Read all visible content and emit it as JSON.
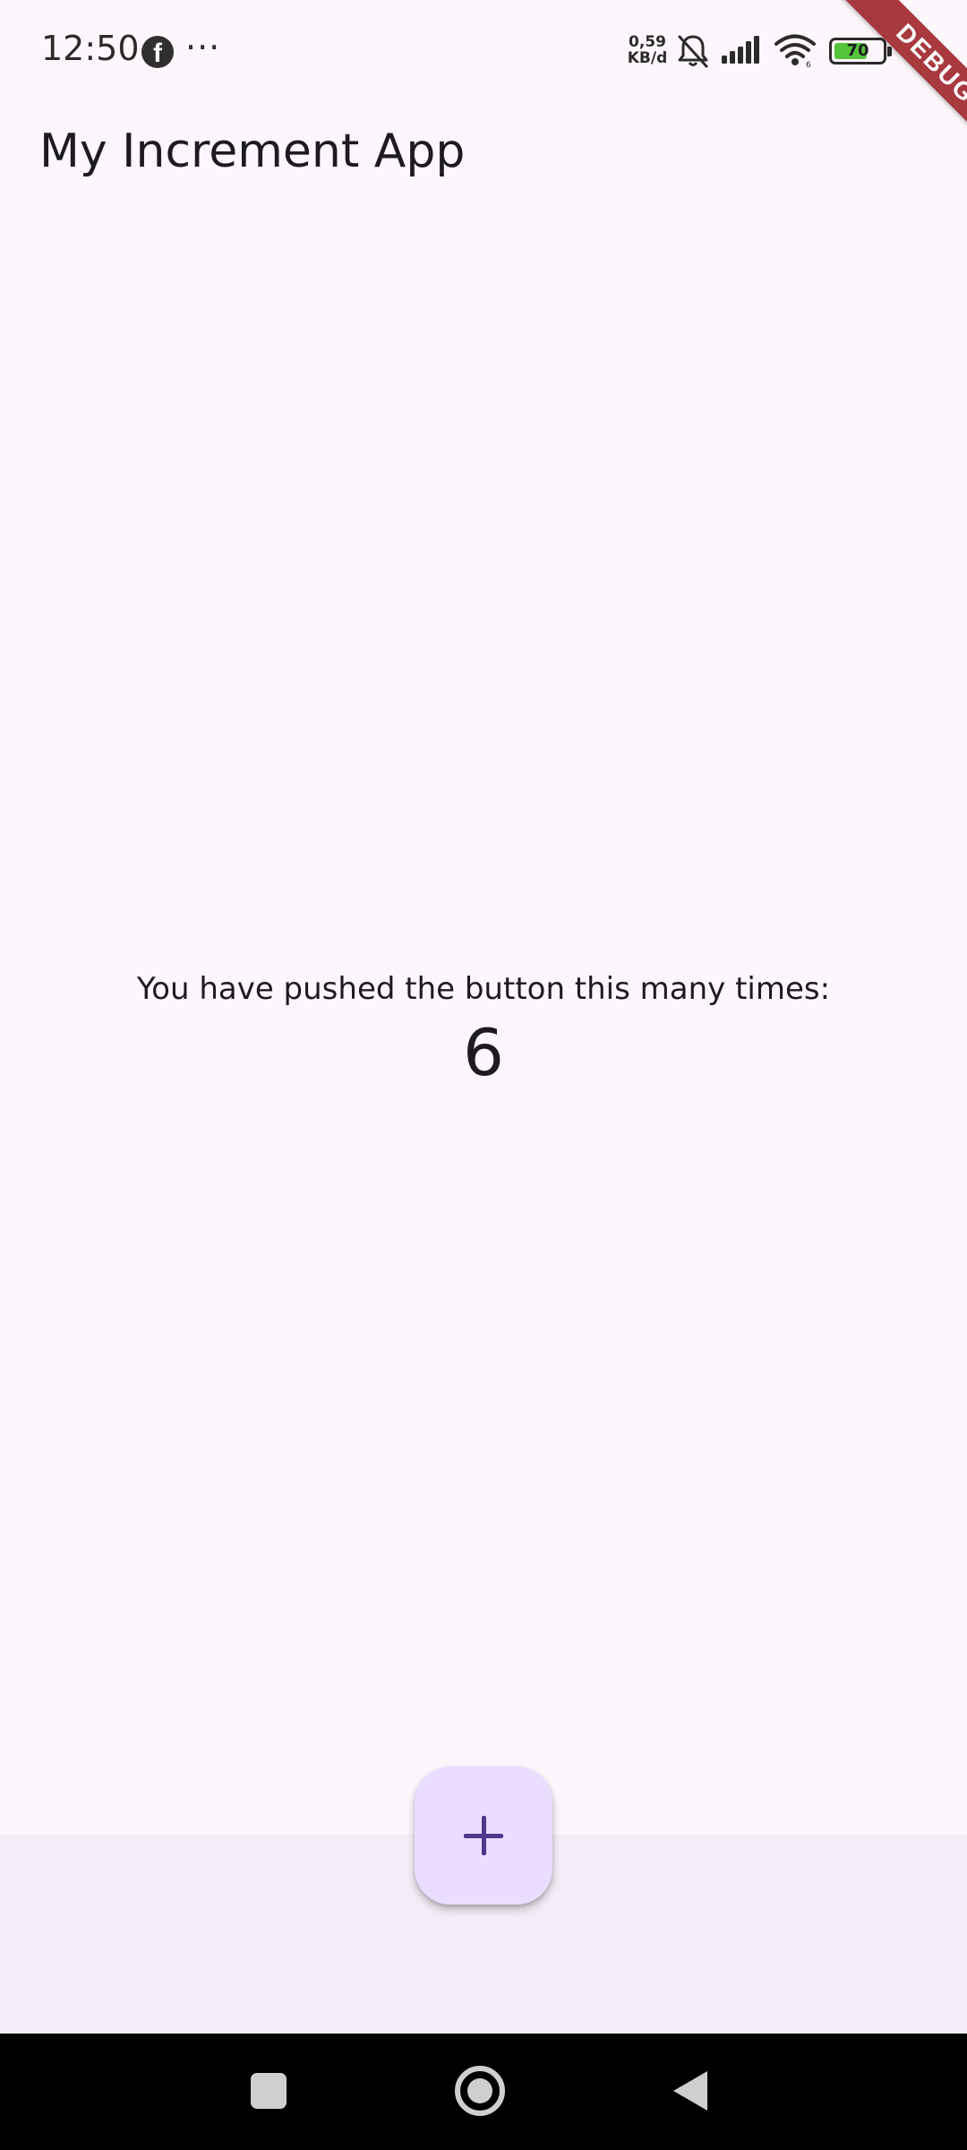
{
  "status_bar": {
    "time": "12:50",
    "notification_icons": [
      "facebook-icon",
      "more-icon"
    ],
    "more_glyph": "···",
    "facebook_glyph": "f",
    "net_speed_value": "0,59",
    "net_speed_unit": "KB/d",
    "system_icons": [
      "bell-off-icon",
      "signal-icon",
      "wifi-icon",
      "battery-icon"
    ],
    "battery_level": "70",
    "battery_fraction": 0.7,
    "battery_color": "#55c43a"
  },
  "debug_banner": {
    "label": "DEBUG",
    "color": "#a8393f"
  },
  "app_bar": {
    "title": "My Increment App"
  },
  "counter": {
    "label": "You have pushed the button this many times:",
    "value": "6"
  },
  "fab": {
    "icon": "add-icon",
    "background": "#eaddff",
    "icon_color": "#4f378b"
  },
  "nav_bar": {
    "buttons": [
      "recents-button",
      "home-button",
      "back-button"
    ]
  },
  "colors": {
    "background": "#fdf7fd",
    "bottom_bar": "#f3edf7"
  }
}
